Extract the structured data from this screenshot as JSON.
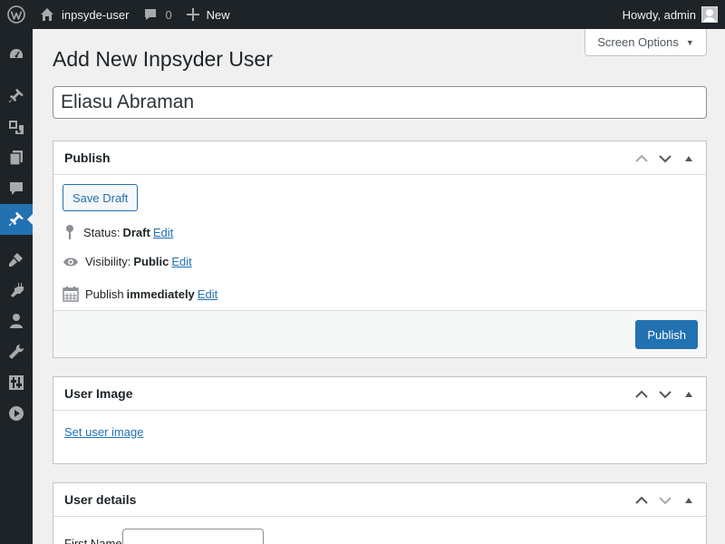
{
  "admin_bar": {
    "site_name": "inpsyde-user",
    "comments_count": "0",
    "new_label": "New",
    "greeting": "Howdy, admin"
  },
  "screen_options": {
    "label": "Screen Options"
  },
  "page": {
    "title": "Add New Inpsyder User",
    "title_value": "Eliasu Abraman"
  },
  "publish_box": {
    "heading": "Publish",
    "save_draft": "Save Draft",
    "status_label": "Status:",
    "status_value": "Draft",
    "visibility_label": "Visibility:",
    "visibility_value": "Public",
    "publish_label": "Publish",
    "publish_value": "immediately",
    "edit": "Edit",
    "publish_button": "Publish"
  },
  "user_image_box": {
    "heading": "User Image",
    "set_image_link": "Set user image"
  },
  "user_details_box": {
    "heading": "User details",
    "first_name_label": "First Name",
    "first_name_value": ""
  },
  "icons": {
    "menu": [
      "dashboard-icon",
      "posts-icon",
      "media-icon",
      "pages-icon",
      "comments-icon",
      "custom-post-icon",
      "appearance-icon",
      "plugins-icon",
      "users-icon",
      "tools-icon",
      "settings-icon",
      "video-icon"
    ]
  },
  "colors": {
    "accent": "#2271b1",
    "admin_bar": "#1d2327",
    "background": "#f0f0f1"
  }
}
